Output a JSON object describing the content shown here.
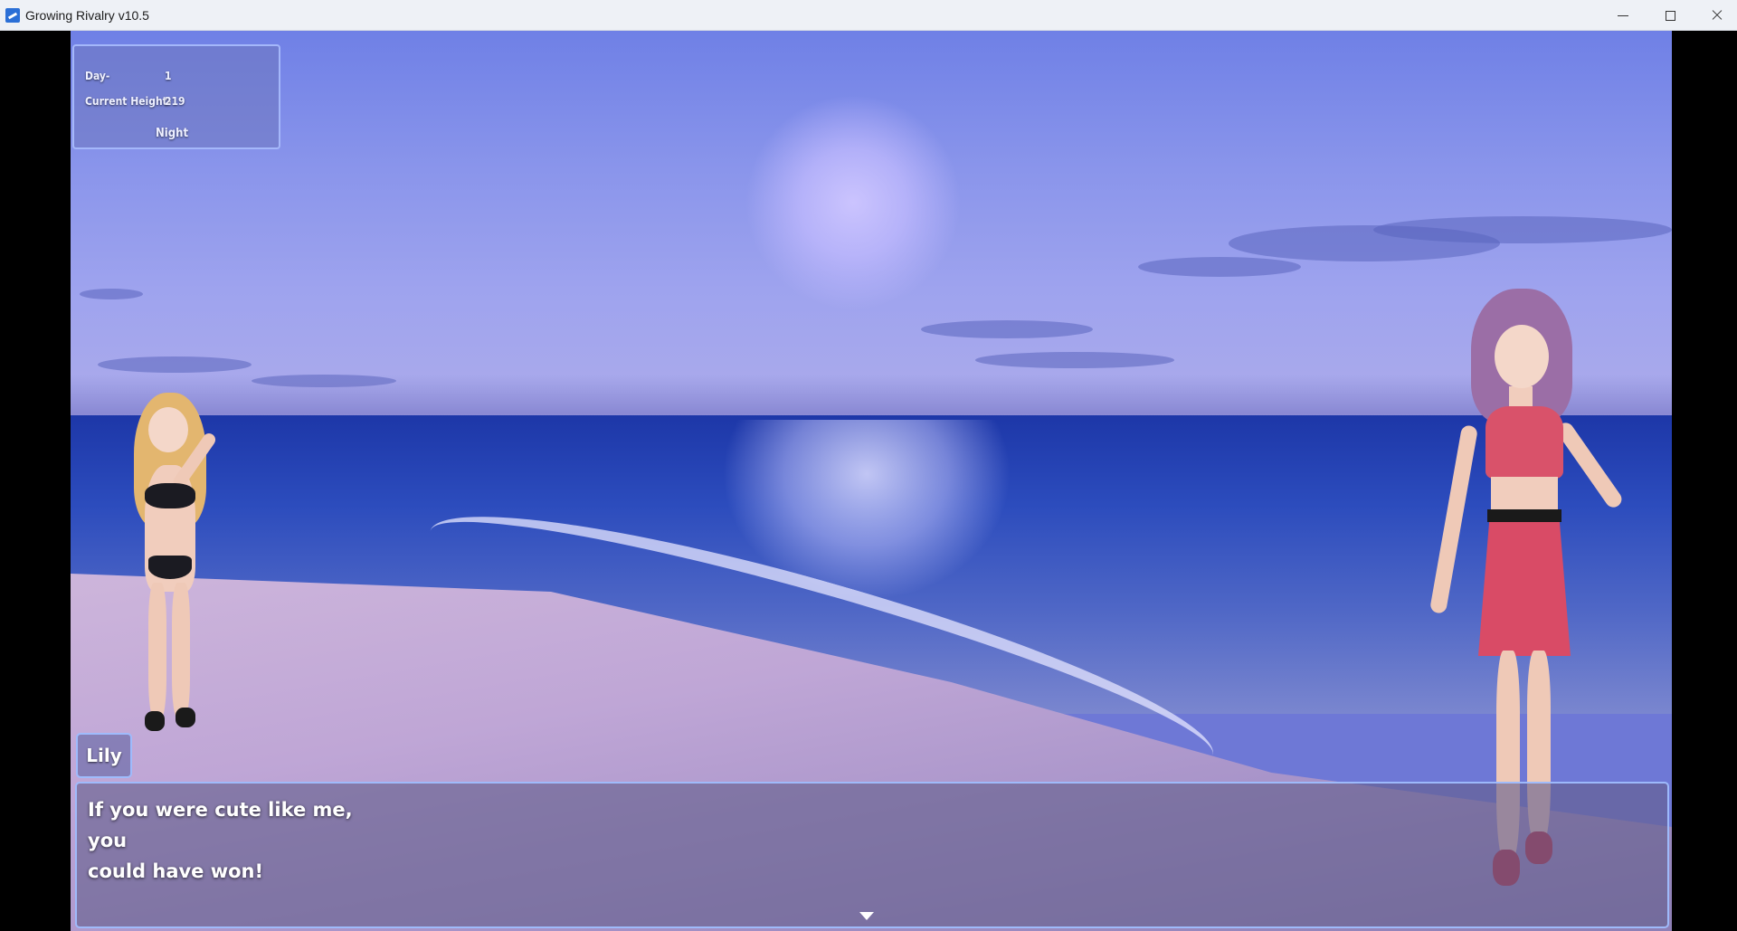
{
  "window": {
    "title": "Growing Rivalry v10.5"
  },
  "hud": {
    "day_label": "Day-",
    "day_value": "1",
    "height_label": "Current Height-",
    "height_value": "219",
    "time_of_day": "Night"
  },
  "dialog": {
    "speaker": "Lily",
    "line1": "If you were cute like me, you",
    "line2": "could have won!"
  },
  "scene": {
    "setting": "beach at night",
    "colors": {
      "sky": "#8a95eb",
      "sea": "#2c4cbd",
      "sand": "#bfa6d6",
      "ui_border": "#a0beff"
    }
  },
  "icons": {
    "app": "app-icon",
    "minimize": "minimize-icon",
    "maximize": "maximize-icon",
    "close": "close-icon",
    "continue": "continue-arrow-icon"
  }
}
